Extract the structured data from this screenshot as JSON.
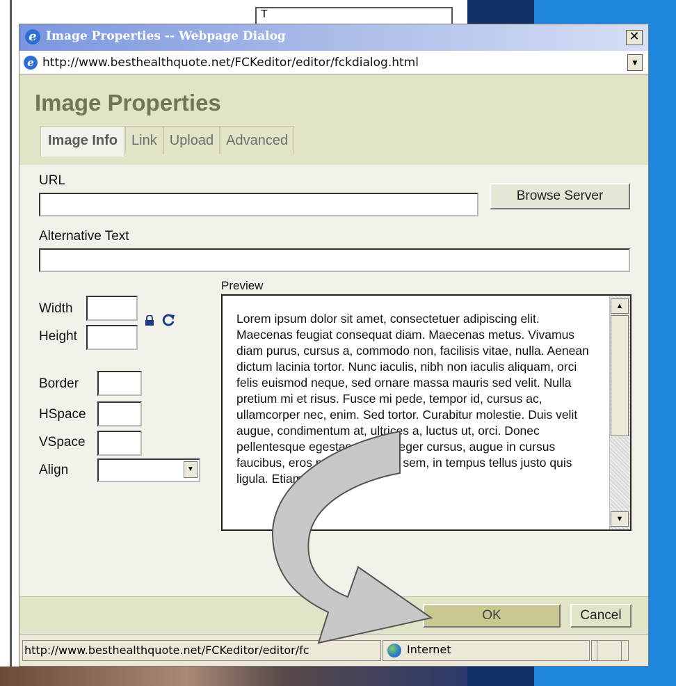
{
  "background": {
    "top_field_text": "T"
  },
  "window": {
    "title": "Image Properties -- Webpage Dialog",
    "close_label": "✕",
    "address": "http://www.besthealthquote.net/FCKeditor/editor/fckdialog.html"
  },
  "dialog": {
    "title": "Image Properties",
    "tabs": [
      {
        "label": "Image Info",
        "active": true
      },
      {
        "label": "Link",
        "active": false
      },
      {
        "label": "Upload",
        "active": false
      },
      {
        "label": "Advanced",
        "active": false
      }
    ],
    "url_label": "URL",
    "url_value": "",
    "browse_label": "Browse Server",
    "alt_label": "Alternative Text",
    "alt_value": "",
    "width_label": "Width",
    "height_label": "Height",
    "border_label": "Border",
    "hspace_label": "HSpace",
    "vspace_label": "VSpace",
    "align_label": "Align",
    "align_value": "",
    "preview_label": "Preview",
    "preview_text": "Lorem ipsum dolor sit amet, consectetuer adipiscing elit. Maecenas feugiat consequat diam. Maecenas metus. Vivamus diam purus, cursus a, commodo non, facilisis vitae, nulla. Aenean dictum lacinia tortor. Nunc iaculis, nibh non iaculis aliquam, orci felis euismod neque, sed ornare massa mauris sed velit. Nulla pretium mi et risus. Fusce mi pede, tempor id, cursus ac, ullamcorper nec, enim. Sed tortor. Curabitur molestie. Duis velit augue, condimentum at, ultrices a, luctus ut, orci. Donec pellentesque egestas eros. Integer cursus, augue in cursus faucibus, eros pede bibendum sem, in tempus tellus justo quis ligula. Etiam",
    "ok_label": "OK",
    "cancel_label": "Cancel"
  },
  "status": {
    "url": "http://www.besthealthquote.net/FCKeditor/editor/fc",
    "zone": "Internet"
  },
  "colors": {
    "header_bg": "#e3e3c7",
    "title_color": "#737357",
    "ok_button": "#c8c890",
    "arrow_fill": "#c8c8c8"
  },
  "icons": [
    "ie-icon",
    "close-icon",
    "lock-icon",
    "reset-size-icon",
    "chevron-down-icon",
    "globe-icon",
    "curved-arrow-icon"
  ]
}
